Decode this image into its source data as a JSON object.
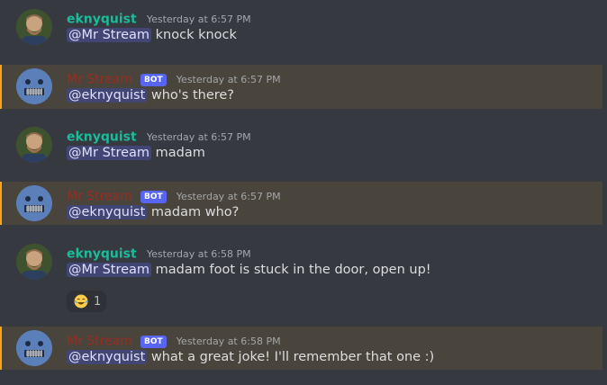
{
  "messages": [
    {
      "author": "eknyquist",
      "is_bot": false,
      "timestamp": "Yesterday at 6:57 PM",
      "mention": "@Mr Stream",
      "text": "knock knock"
    },
    {
      "author": "Mr Stream",
      "is_bot": true,
      "badge": "BOT",
      "timestamp": "Yesterday at 6:57 PM",
      "mention": "@eknyquist",
      "text": "who's there?"
    },
    {
      "author": "eknyquist",
      "is_bot": false,
      "timestamp": "Yesterday at 6:57 PM",
      "mention": "@Mr Stream",
      "text": "madam"
    },
    {
      "author": "Mr Stream",
      "is_bot": true,
      "badge": "BOT",
      "timestamp": "Yesterday at 6:57 PM",
      "mention": "@eknyquist",
      "text": "madam who?"
    },
    {
      "author": "eknyquist",
      "is_bot": false,
      "timestamp": "Yesterday at 6:58 PM",
      "mention": "@Mr Stream",
      "text": "madam foot is stuck in the door, open up!",
      "reaction": {
        "emoji": "joy-emoji",
        "count": "1"
      }
    },
    {
      "author": "Mr Stream",
      "is_bot": true,
      "badge": "BOT",
      "timestamp": "Yesterday at 6:58 PM",
      "mention": "@eknyquist",
      "text": "what a great joke! I'll remember that one :)"
    }
  ],
  "colors": {
    "background": "#36393f",
    "highlight": "#49443c",
    "highlight_bar": "#faa61a",
    "user_name": "#1abc9c",
    "bot_name": "#992d22",
    "bot_badge": "#5865f2",
    "mention_bg": "#414675"
  }
}
